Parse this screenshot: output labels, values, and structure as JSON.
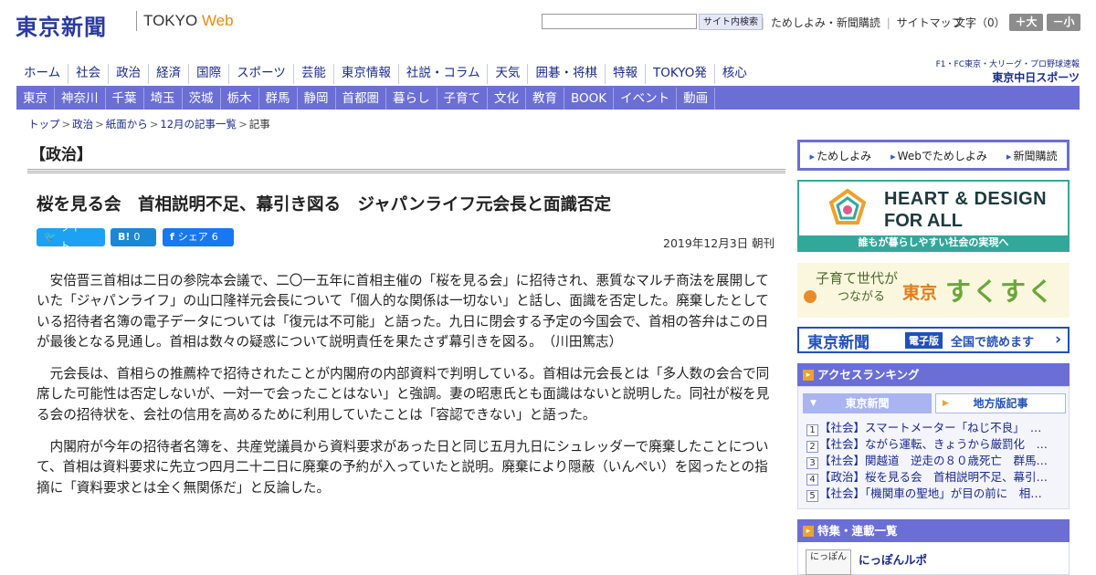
{
  "header": {
    "logo": "東京新聞",
    "tokyo_label": "TOKYO",
    "web_label": "Web",
    "search_button": "サイト内検索",
    "toplinks": [
      "ためしよみ・新聞購読",
      "サイトマップ"
    ],
    "font_size_label": "文字（0）",
    "font_larger": "＋大",
    "font_smaller": "－小"
  },
  "main_nav": [
    "ホーム",
    "社会",
    "政治",
    "経済",
    "国際",
    "スポーツ",
    "芸能",
    "東京情報",
    "社説・コラム",
    "天気",
    "囲碁・将棋",
    "特報",
    "TOKYO発",
    "核心"
  ],
  "chunichi": {
    "line1": "F1・FC東京・大リーグ・プロ野球速報",
    "line2": "東京中日スポーツ"
  },
  "sub_nav": [
    "東京",
    "神奈川",
    "千葉",
    "埼玉",
    "茨城",
    "栃木",
    "群馬",
    "静岡",
    "首都圏",
    "暮らし",
    "子育て",
    "文化",
    "教育",
    "BOOK",
    "イベント",
    "動画"
  ],
  "breadcrumb": [
    "トップ",
    "政治",
    "紙面から",
    "12月の記事一覧",
    "記事"
  ],
  "article": {
    "section": "【政治】",
    "headline": "桜を見る会　首相説明不足、幕引き図る　ジャパンライフ元会長と面識否定",
    "share": {
      "tweet": "ツイート",
      "hatena": "B!",
      "hatena_count": "0",
      "facebook": "シェア",
      "facebook_count": "6"
    },
    "date": "2019年12月3日 朝刊",
    "paragraphs": [
      "安倍晋三首相は二日の参院本会議で、二〇一五年に首相主催の「桜を見る会」に招待され、悪質なマルチ商法を展開していた「ジャパンライフ」の山口隆祥元会長について「個人的な関係は一切ない」と話し、面識を否定した。廃棄したとしている招待者名簿の電子データについては「復元は不可能」と語った。九日に閉会する予定の今国会で、首相の答弁はこの日が最後となる見通し。首相は数々の疑惑について説明責任を果たさず幕引きを図る。　（川田篤志）",
      "元会長は、首相らの推薦枠で招待されたことが内閣府の内部資料で判明している。首相は元会長とは「多人数の会合で同席した可能性は否定しないが、一対一で会ったことはない」と強調。妻の昭恵氏とも面識はないと説明した。同社が桜を見る会の招待状を、会社の信用を高めるために利用していたことは「容認できない」と語った。",
      "内閣府が今年の招待者名簿を、共産党議員から資料要求があった日と同じ五月九日にシュレッダーで廃棄したことについて、首相は資料要求に先立つ四月二十二日に廃棄の予約が入っていたと説明。廃棄により隠蔽（いんぺい）を図ったとの指摘に「資料要求とは全く無関係だ」と反論した。"
    ]
  },
  "sidebar": {
    "tameshi": [
      "ためしよみ",
      "Webでためしよみ",
      "新聞購読"
    ],
    "heart": {
      "line1": "HEART & DESIGN",
      "line2": "FOR ALL",
      "footer": "誰もが暮らしやすい社会の実現へ"
    },
    "sukusuku": {
      "line1": "子育て世代が",
      "line2": "つながる",
      "tokyo": "東京",
      "name": "すくすく"
    },
    "denshi": {
      "logo": "東京新聞",
      "badge": "電子版",
      "text": "全国で読めます"
    },
    "ranking": {
      "title": "アクセスランキング",
      "tab_active": "東京新聞",
      "tab_inactive": "地方版記事",
      "items": [
        "【社会】スマートメーター「ねじ不良」　…",
        "【社会】ながら運転、きょうから厳罰化　…",
        "【社会】関越道　逆走の８０歳死亡　群馬…",
        "【政治】桜を見る会　首相説明不足、幕引…",
        "【社会】「機関車の聖地」が目の前に　相…"
      ]
    },
    "features": {
      "title": "特集・連載一覧",
      "thumb": "にっぽん",
      "item": "にっぽんルポ"
    }
  },
  "colors": {
    "nav_purple": "#6b6ed4",
    "brand_blue": "#2a3b9c",
    "teal": "#34a79b",
    "orange": "#f1a12b"
  }
}
